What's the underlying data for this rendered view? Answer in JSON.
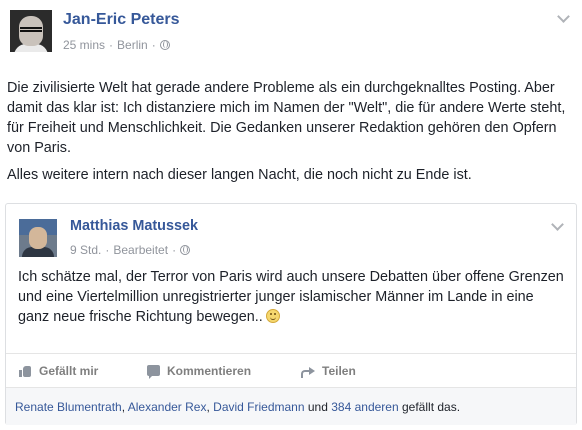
{
  "post": {
    "author": "Jan-Eric Peters",
    "time": "25 mins",
    "location": "Berlin",
    "separator": "·",
    "paragraphs": [
      "Die zivilisierte Welt hat gerade andere Probleme als ein durchgeknalltes Posting. Aber damit das klar ist: Ich distanziere mich im Namen der \"Welt\", die für andere Werte steht, für Freiheit und Menschlichkeit. Die Gedanken unserer Redaktion gehören den Opfern von Paris.",
      "Alles weitere intern nach dieser langen Nacht, die noch nicht zu Ende ist."
    ]
  },
  "shared": {
    "author": "Matthias Matussek",
    "time": "9 Std.",
    "edited": "Bearbeitet",
    "separator": "·",
    "text": "Ich schätze mal, der Terror von Paris wird auch unsere Debatten über offene Grenzen und eine Viertelmillion unregistrierter junger islamischer Männer im Lande in eine ganz neue frische Richtung bewegen..",
    "emoji": "smiley-emoji",
    "actions": {
      "like": "Gefällt mir",
      "comment": "Kommentieren",
      "share": "Teilen"
    },
    "likes": {
      "names": [
        "Renate Blumentrath",
        "Alexander Rex",
        "David Friedmann"
      ],
      "comma": ",",
      "and": "und",
      "others_count": "384 anderen",
      "suffix": "gefällt das."
    }
  },
  "colors": {
    "link": "#365899",
    "meta": "#90949c",
    "text": "#1d2129"
  }
}
